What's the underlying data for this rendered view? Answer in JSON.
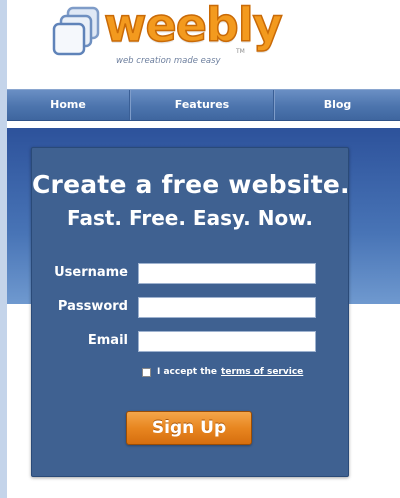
{
  "logo": {
    "name": "weebly",
    "tagline": "web creation made easy",
    "trademark": "TM",
    "brand_color": "#f39a1e",
    "icon": "stacked-pages-icon"
  },
  "nav": {
    "items": [
      {
        "label": "Home"
      },
      {
        "label": "Features"
      },
      {
        "label": "Blog"
      }
    ],
    "color": "#4c74ad"
  },
  "signup": {
    "title": "Create a free website.",
    "subtitle": "Fast. Free. Easy. Now.",
    "username_label": "Username",
    "username_value": "",
    "password_label": "Password",
    "password_value": "",
    "email_label": "Email",
    "email_value": "",
    "terms_prefix": "I accept the",
    "terms_link": "terms of service",
    "terms_checked": false,
    "button_label": "Sign Up",
    "panel_color": "#3f6191",
    "button_color": "#e88620"
  }
}
